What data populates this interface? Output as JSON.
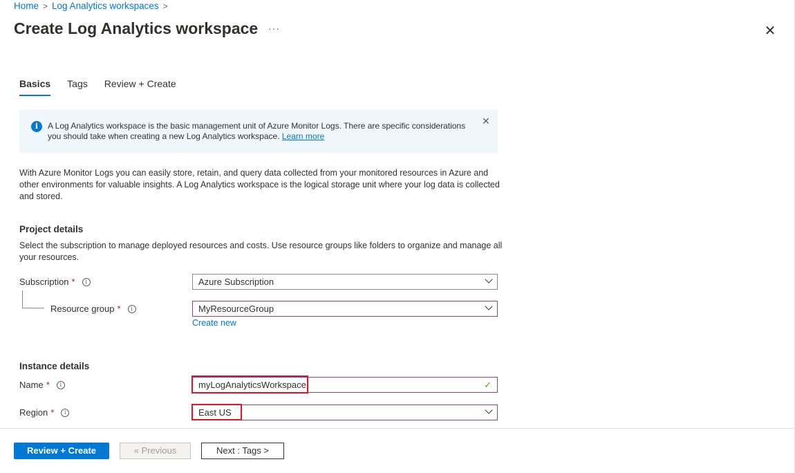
{
  "breadcrumb": {
    "items": [
      "Home",
      "Log Analytics workspaces"
    ],
    "separator": ">"
  },
  "header": {
    "title": "Create Log Analytics workspace",
    "more_label": "···",
    "close_label": "✕"
  },
  "tabs": [
    {
      "label": "Basics",
      "active": true
    },
    {
      "label": "Tags",
      "active": false
    },
    {
      "label": "Review + Create",
      "active": false
    }
  ],
  "info_bar": {
    "icon": "info-icon",
    "text": "A Log Analytics workspace is the basic management unit of Azure Monitor Logs. There are specific considerations you should take when creating a new Log Analytics workspace.",
    "link": "Learn more",
    "close_label": "✕"
  },
  "description": "With Azure Monitor Logs you can easily store, retain, and query data collected from your monitored resources in Azure and other environments for valuable insights. A Log Analytics workspace is the logical storage unit where your log data is collected and stored.",
  "project_details": {
    "title": "Project details",
    "description": "Select the subscription to manage deployed resources and costs. Use resource groups like folders to organize and manage all your resources.",
    "subscription": {
      "label": "Subscription",
      "required": "*",
      "value": "Azure Subscription"
    },
    "resource_group": {
      "label": "Resource group",
      "required": "*",
      "value": "MyResourceGroup",
      "create_new": "Create new"
    }
  },
  "instance_details": {
    "title": "Instance details",
    "name": {
      "label": "Name",
      "required": "*",
      "value": "myLogAnalyticsWorkspace",
      "valid_icon": "✓"
    },
    "region": {
      "label": "Region",
      "required": "*",
      "value": "East US"
    }
  },
  "footer": {
    "review_create": "Review + Create",
    "previous": "« Previous",
    "next": "Next : Tags >"
  },
  "colors": {
    "accent": "#0078d4",
    "highlight": "#e81123",
    "focus_border": "#8c3fa8"
  }
}
